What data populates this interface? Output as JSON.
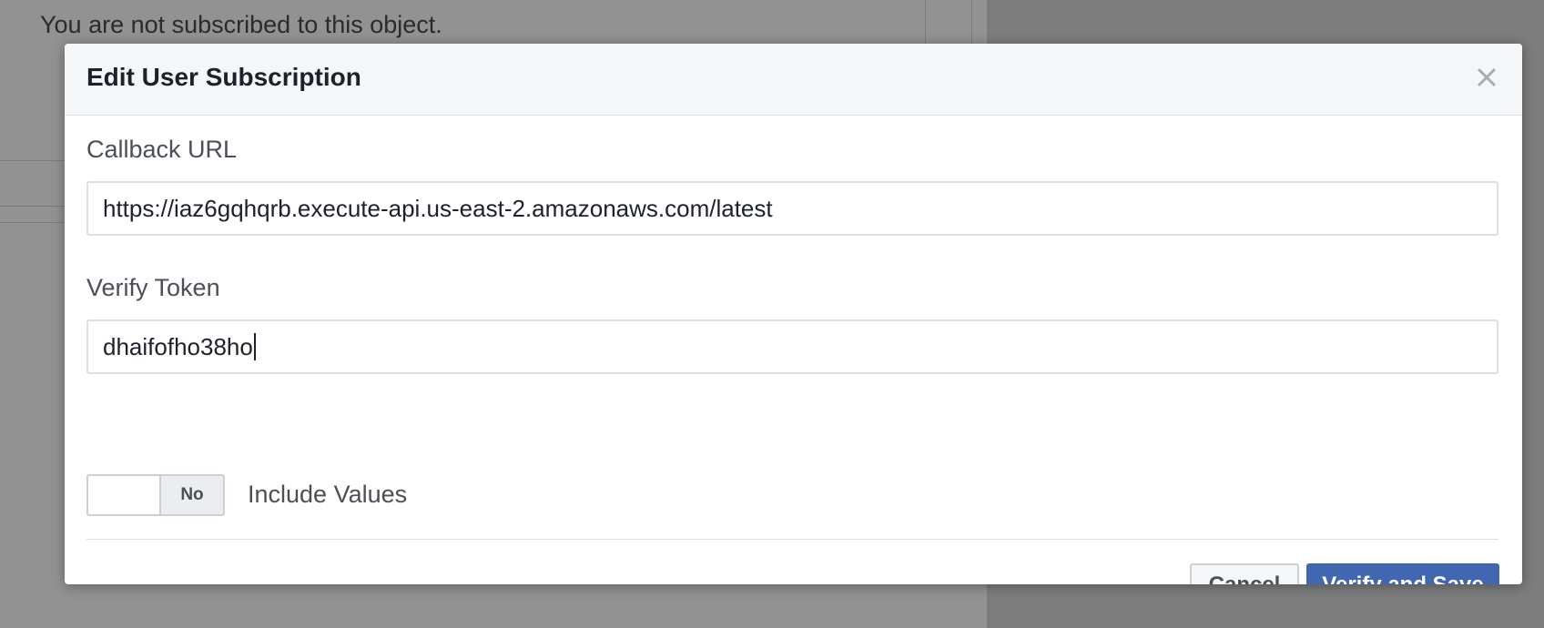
{
  "background": {
    "notice_text": "You are not subscribed to this object."
  },
  "modal": {
    "title": "Edit User Subscription",
    "close_icon": "close-icon",
    "callback_url": {
      "label": "Callback URL",
      "value": "https://iaz6gqhqrb.execute-api.us-east-2.amazonaws.com/latest"
    },
    "verify_token": {
      "label": "Verify Token",
      "value": "dhaifofho38ho"
    },
    "include_values": {
      "state_label": "No",
      "label": "Include Values",
      "enabled": false
    },
    "buttons": {
      "cancel": "Cancel",
      "submit": "Verify and Save"
    }
  },
  "colors": {
    "primary": "#4267b2",
    "header_bg": "#f5f6f7",
    "text_dark": "#1d2129",
    "text_label": "#4b4f56"
  }
}
